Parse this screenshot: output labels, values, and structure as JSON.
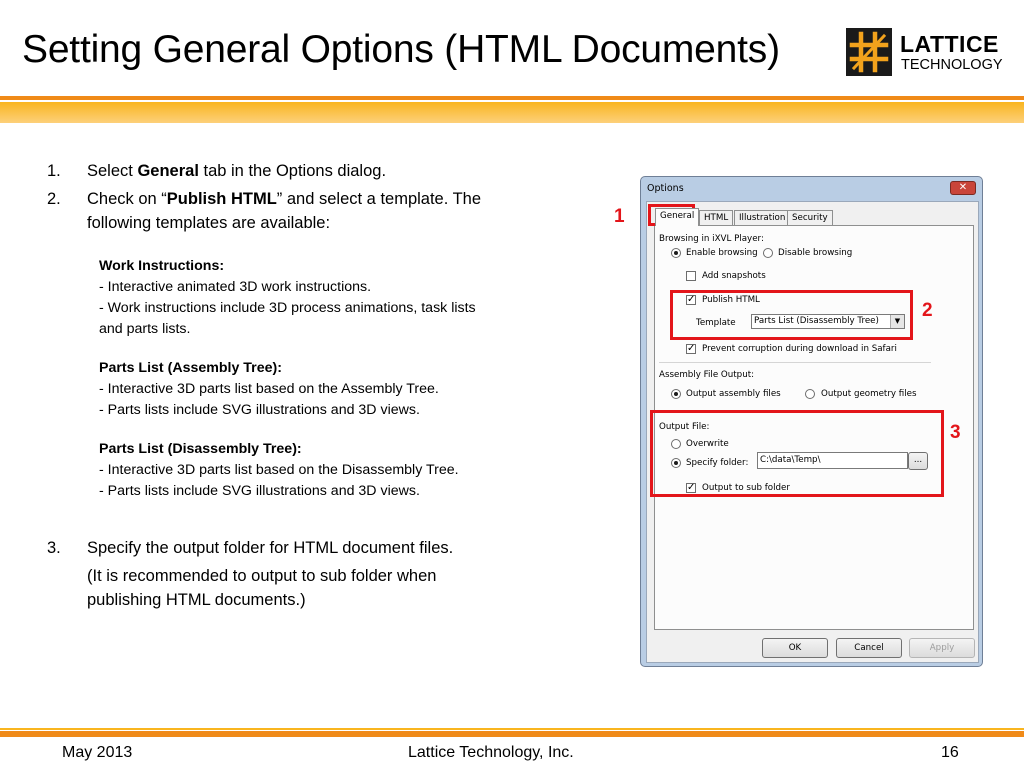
{
  "slide": {
    "title": "Setting General Options (HTML Documents)",
    "logo": {
      "line1": "LATTICE",
      "line2": "TECHNOLOGY",
      "name": "lattice-logo"
    },
    "colors": {
      "accent_orange": "#f08a18",
      "accent_yellow": "#f9b51f",
      "highlight_red": "#e3151a"
    }
  },
  "steps": [
    {
      "number": "1.",
      "before": "Select ",
      "bold": "General",
      "after": " tab in the Options dialog."
    },
    {
      "number": "2.",
      "before": "Check on “",
      "bold": "Publish HTML",
      "after": "” and select a template. The",
      "line2": "following templates are available:"
    },
    {
      "number": "3.",
      "text": "Specify the output folder for HTML document files.",
      "note_line1": "(It is recommended to output to sub folder when",
      "note_line2": "publishing HTML documents.)"
    }
  ],
  "templates": [
    {
      "title": "Work Instructions:",
      "lines": [
        "- Interactive animated 3D work instructions.",
        "- Work instructions include 3D process animations, task lists",
        "and parts lists."
      ]
    },
    {
      "title": "Parts List (Assembly Tree):",
      "lines": [
        "- Interactive 3D parts list based on the Assembly Tree.",
        "- Parts lists include SVG illustrations and 3D views."
      ]
    },
    {
      "title": "Parts List (Disassembly Tree):",
      "lines": [
        "- Interactive 3D parts list based on the Disassembly Tree.",
        "- Parts lists include SVG illustrations and 3D views."
      ]
    }
  ],
  "dialog": {
    "title": "Options",
    "close_glyph": "✕",
    "tabs": [
      "General",
      "HTML",
      "Illustration",
      "Security"
    ],
    "browsing": {
      "label": "Browsing in iXVL Player:",
      "enable": "Enable browsing",
      "enable_selected": true,
      "disable": "Disable browsing",
      "add_snapshots": "Add snapshots",
      "add_snapshots_checked": false,
      "publish_html": "Publish HTML",
      "publish_html_checked": true,
      "template_label": "Template",
      "template_value": "Parts List (Disassembly Tree)",
      "prevent_corruption": "Prevent corruption during download in Safari",
      "prevent_corruption_checked": true
    },
    "assembly_output": {
      "label": "Assembly File Output:",
      "assembly": "Output assembly files",
      "assembly_selected": true,
      "geometry": "Output geometry files"
    },
    "output_file": {
      "label": "Output File:",
      "overwrite": "Overwrite",
      "overwrite_selected": false,
      "specify": "Specify folder:",
      "specify_selected": true,
      "folder_value": "C:\\data\\Temp\\",
      "browse": "...",
      "sub_folder": "Output to sub folder",
      "sub_folder_checked": true
    },
    "buttons": {
      "ok": "OK",
      "cancel": "Cancel",
      "apply": "Apply"
    },
    "check_glyph": "✓"
  },
  "callouts": [
    "1",
    "2",
    "3"
  ],
  "footer": {
    "date": "May 2013",
    "company": "Lattice Technology, Inc.",
    "page": "16"
  }
}
